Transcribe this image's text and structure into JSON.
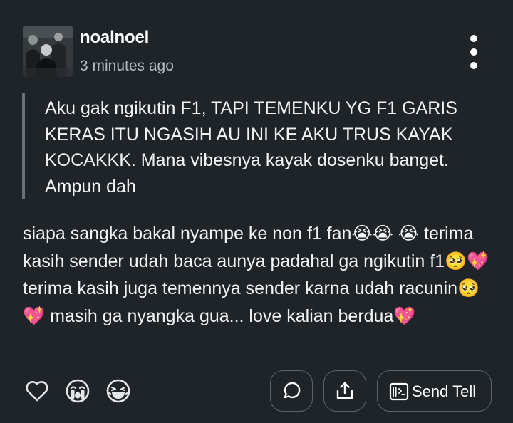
{
  "post": {
    "username": "noalnoel",
    "timestamp": "3 minutes ago",
    "quote": "Aku gak ngikutin F1, TAPI TEMENKU YG F1 GARIS KERAS ITU NGASIH AU INI KE AKU TRUS KAYAK KOCAKKK. Mana vibesnya kayak dosenku banget. Ampun dah",
    "reply_segments": [
      "siapa sangka bakal nyampe ke non f1 fan",
      "😭😭",
      " ",
      "😭",
      " terima kasih sender udah baca aunya padahal ga ngikutin f1",
      "🥺💖",
      " terima kasih juga temennya sender karna udah racunin",
      "🥺💖",
      " masih ga nyangka gua... love kalian berdua",
      "💖"
    ]
  },
  "actions": {
    "send_label": "Send Tell"
  },
  "icons": {
    "more": "more-vertical-icon",
    "like": "heart-outline-icon",
    "cry": "crying-face-icon",
    "laugh": "laughing-face-icon",
    "comment": "comment-bubble-icon",
    "share": "share-upload-icon",
    "send": "tell-card-icon"
  },
  "colors": {
    "background": "#1f2429",
    "text": "#f1f3f5",
    "muted": "#b6bcc2",
    "quote_bar": "#6b7177",
    "pill_border": "#5d646a"
  }
}
